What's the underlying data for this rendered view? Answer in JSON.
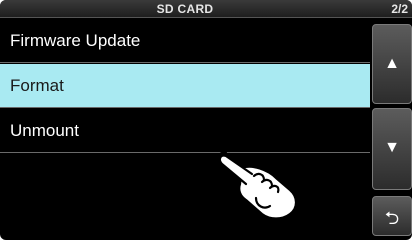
{
  "header": {
    "title": "SD CARD",
    "page": "2/2"
  },
  "menu": {
    "items": [
      {
        "label": "Firmware Update",
        "selected": false
      },
      {
        "label": "Format",
        "selected": true
      },
      {
        "label": "Unmount",
        "selected": false
      }
    ]
  },
  "controls": {
    "up_icon": "triangle-up",
    "down_icon": "triangle-down",
    "back_icon": "return-arrow"
  },
  "colors": {
    "background": "#000000",
    "selected_row": "#a9eaf2",
    "text": "#ffffff"
  }
}
